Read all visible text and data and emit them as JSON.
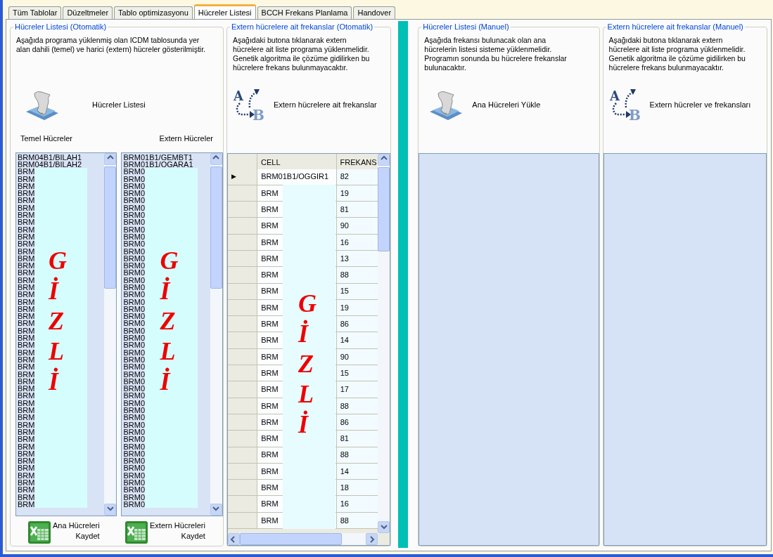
{
  "tabs": [
    {
      "label": "Tüm Tablolar",
      "selected": false
    },
    {
      "label": "Düzeltmeler",
      "selected": false
    },
    {
      "label": "Tablo optimizasyonu",
      "selected": false
    },
    {
      "label": "Hücreler Listesi",
      "selected": true
    },
    {
      "label": "BCCH Frekans Planlama",
      "selected": false
    },
    {
      "label": "Handover",
      "selected": false
    }
  ],
  "auto_cells": {
    "title": "Hücreler Listesi (Otomatik)",
    "description": "Aşağıda programa yüklenmiş olan ICDM tablosunda yer\nalan dahili (temel) ve harici (extern) hücreler gösterilmiştir.",
    "load_button": "Hücreler Listesi",
    "temel_label": "Temel Hücreler",
    "extern_label": "Extern Hücreler",
    "temel_list": [
      {
        "text": "BRM04B1/BILAH1",
        "redacted": false
      },
      {
        "text": "BRM04B1/BILAH2",
        "redacted": false
      },
      {
        "text": "BRM",
        "redacted": true
      },
      {
        "text": "BRM",
        "redacted": true
      },
      {
        "text": "BRM",
        "redacted": true
      },
      {
        "text": "BRM",
        "redacted": true
      },
      {
        "text": "BRM",
        "redacted": true
      },
      {
        "text": "BRM",
        "redacted": true
      },
      {
        "text": "BRM",
        "redacted": true
      },
      {
        "text": "BRM",
        "redacted": true
      },
      {
        "text": "BRM",
        "redacted": true
      },
      {
        "text": "BRM",
        "redacted": true
      },
      {
        "text": "BRM",
        "redacted": true
      },
      {
        "text": "BRM",
        "redacted": true
      },
      {
        "text": "BRM",
        "redacted": true
      },
      {
        "text": "BRM",
        "redacted": true
      },
      {
        "text": "BRM",
        "redacted": true
      },
      {
        "text": "BRM",
        "redacted": true
      },
      {
        "text": "BRM",
        "redacted": true
      },
      {
        "text": "BRM",
        "redacted": true
      },
      {
        "text": "BRM",
        "redacted": true
      },
      {
        "text": "BRM",
        "redacted": true
      },
      {
        "text": "BRM",
        "redacted": true
      },
      {
        "text": "BRM",
        "redacted": true
      },
      {
        "text": "BRM",
        "redacted": true
      },
      {
        "text": "BRM",
        "redacted": true
      },
      {
        "text": "BRM",
        "redacted": true
      },
      {
        "text": "BRM",
        "redacted": true
      },
      {
        "text": "BRM",
        "redacted": true
      },
      {
        "text": "BRM",
        "redacted": true
      },
      {
        "text": "BRM",
        "redacted": true
      },
      {
        "text": "BRM",
        "redacted": true
      },
      {
        "text": "BRM",
        "redacted": true
      },
      {
        "text": "BRM",
        "redacted": true
      },
      {
        "text": "BRM",
        "redacted": true
      },
      {
        "text": "BRM",
        "redacted": true
      },
      {
        "text": "BRM",
        "redacted": true
      },
      {
        "text": "BRM",
        "redacted": true
      },
      {
        "text": "BRM",
        "redacted": true
      },
      {
        "text": "BRM",
        "redacted": true
      },
      {
        "text": "BRM",
        "redacted": true
      },
      {
        "text": "BRM",
        "redacted": true
      },
      {
        "text": "BRM",
        "redacted": true
      },
      {
        "text": "BRM",
        "redacted": true
      },
      {
        "text": "BRM",
        "redacted": true
      },
      {
        "text": "BRM",
        "redacted": true
      },
      {
        "text": "BRM",
        "redacted": true
      },
      {
        "text": "BRM",
        "redacted": true
      },
      {
        "text": "BRM",
        "redacted": true
      }
    ],
    "extern_list": [
      {
        "text": "BRM01B1/GEMBT1",
        "redacted": false
      },
      {
        "text": "BRM01B1/OGARA1",
        "redacted": false
      },
      {
        "text": "BRM0",
        "redacted": true
      },
      {
        "text": "BRM0",
        "redacted": true
      },
      {
        "text": "BRM0",
        "redacted": true
      },
      {
        "text": "BRM0",
        "redacted": true
      },
      {
        "text": "BRM0",
        "redacted": true
      },
      {
        "text": "BRM0",
        "redacted": true
      },
      {
        "text": "BRM0",
        "redacted": true
      },
      {
        "text": "BRM0",
        "redacted": true
      },
      {
        "text": "BRM0",
        "redacted": true
      },
      {
        "text": "BRM0",
        "redacted": true
      },
      {
        "text": "BRM0",
        "redacted": true
      },
      {
        "text": "BRM0",
        "redacted": true
      },
      {
        "text": "BRM0",
        "redacted": true
      },
      {
        "text": "BRM0",
        "redacted": true
      },
      {
        "text": "BRM0",
        "redacted": true
      },
      {
        "text": "BRM0",
        "redacted": true
      },
      {
        "text": "BRM0",
        "redacted": true
      },
      {
        "text": "BRM0",
        "redacted": true
      },
      {
        "text": "BRM0",
        "redacted": true
      },
      {
        "text": "BRM0",
        "redacted": true
      },
      {
        "text": "BRM0",
        "redacted": true
      },
      {
        "text": "BRM0",
        "redacted": true
      },
      {
        "text": "BRM0",
        "redacted": true
      },
      {
        "text": "BRM0",
        "redacted": true
      },
      {
        "text": "BRM0",
        "redacted": true
      },
      {
        "text": "BRM0",
        "redacted": true
      },
      {
        "text": "BRM0",
        "redacted": true
      },
      {
        "text": "BRM0",
        "redacted": true
      },
      {
        "text": "BRM0",
        "redacted": true
      },
      {
        "text": "BRM0",
        "redacted": true
      },
      {
        "text": "BRM0",
        "redacted": true
      },
      {
        "text": "BRM0",
        "redacted": true
      },
      {
        "text": "BRM0",
        "redacted": true
      },
      {
        "text": "BRM0",
        "redacted": true
      },
      {
        "text": "BRM0",
        "redacted": true
      },
      {
        "text": "BRM0",
        "redacted": true
      },
      {
        "text": "BRM0",
        "redacted": true
      },
      {
        "text": "BRM0",
        "redacted": true
      },
      {
        "text": "BRM0",
        "redacted": true
      },
      {
        "text": "BRM0",
        "redacted": true
      },
      {
        "text": "BRM0",
        "redacted": true
      },
      {
        "text": "BRM0",
        "redacted": true
      },
      {
        "text": "BRM0",
        "redacted": true
      },
      {
        "text": "BRM0",
        "redacted": true
      },
      {
        "text": "BRM0",
        "redacted": true
      },
      {
        "text": "BRM0",
        "redacted": true
      },
      {
        "text": "BRM0",
        "redacted": true
      }
    ],
    "redaction_labels": [
      "GİZLİ",
      "GİZLİ"
    ],
    "save_temel": "Ana Hücreleri\nKaydet",
    "save_extern": "Extern Hücreleri\nKaydet"
  },
  "auto_freqs": {
    "title": "Extern hücrelere ait frekanslar (Otomatik)",
    "description": "Aşağıdaki butona tıklanarak extern\nhücrelere ait liste programa yüklenmelidir.\nGenetik algoritma ile çözüme gidilirken bu\nhücrelere frekans bulunmayacaktır.",
    "icon_from": "A",
    "icon_to": "B",
    "load_button": "Extern hücrelere ait frekanslar",
    "columns": [
      "CELL",
      "FREKANS"
    ],
    "current_marker": "▶",
    "redaction_label": "GİZLİ",
    "rows": [
      {
        "cell": "BRM01B1/OGGIR1",
        "frekans": "82",
        "current": true,
        "redacted": false
      },
      {
        "cell": "BRM",
        "frekans": "19",
        "current": false,
        "redacted": true
      },
      {
        "cell": "BRM",
        "frekans": "81",
        "current": false,
        "redacted": true
      },
      {
        "cell": "BRM",
        "frekans": "90",
        "current": false,
        "redacted": true
      },
      {
        "cell": "BRM",
        "frekans": "16",
        "current": false,
        "redacted": true
      },
      {
        "cell": "BRM",
        "frekans": "13",
        "current": false,
        "redacted": true
      },
      {
        "cell": "BRM",
        "frekans": "88",
        "current": false,
        "redacted": true
      },
      {
        "cell": "BRM",
        "frekans": "15",
        "current": false,
        "redacted": true
      },
      {
        "cell": "BRM",
        "frekans": "19",
        "current": false,
        "redacted": true
      },
      {
        "cell": "BRM",
        "frekans": "86",
        "current": false,
        "redacted": true
      },
      {
        "cell": "BRM",
        "frekans": "14",
        "current": false,
        "redacted": true
      },
      {
        "cell": "BRM",
        "frekans": "90",
        "current": false,
        "redacted": true
      },
      {
        "cell": "BRM",
        "frekans": "15",
        "current": false,
        "redacted": true
      },
      {
        "cell": "BRM",
        "frekans": "17",
        "current": false,
        "redacted": true
      },
      {
        "cell": "BRM",
        "frekans": "88",
        "current": false,
        "redacted": true
      },
      {
        "cell": "BRM",
        "frekans": "86",
        "current": false,
        "redacted": true
      },
      {
        "cell": "BRM",
        "frekans": "81",
        "current": false,
        "redacted": true
      },
      {
        "cell": "BRM",
        "frekans": "88",
        "current": false,
        "redacted": true
      },
      {
        "cell": "BRM",
        "frekans": "14",
        "current": false,
        "redacted": true
      },
      {
        "cell": "BRM",
        "frekans": "18",
        "current": false,
        "redacted": true
      },
      {
        "cell": "BRM",
        "frekans": "16",
        "current": false,
        "redacted": true
      },
      {
        "cell": "BRM",
        "frekans": "88",
        "current": false,
        "redacted": true
      }
    ]
  },
  "manual_cells": {
    "title": "Hücreler Listesi (Manuel)",
    "description": "Aşağıda frekansı bulunacak olan ana\nhücrelerin listesi sisteme yüklenmelidir.\nProgramın sonunda bu hücrelere frekanslar\nbulunacaktır.",
    "load_button": "Ana Hücreleri Yükle"
  },
  "manual_freqs": {
    "title": "Extern hücrelere ait frekanslar (Manuel)",
    "description": "Aşağıdaki butona tıklanarak extern\nhücrelere ait liste programa yüklenmelidir.\nGenetik algoritma ile çözüme gidilirken bu\nhücrelere frekans bulunmayacaktır.",
    "icon_from": "A",
    "icon_to": "B",
    "load_button": "Extern hücreler ve frekansları"
  }
}
